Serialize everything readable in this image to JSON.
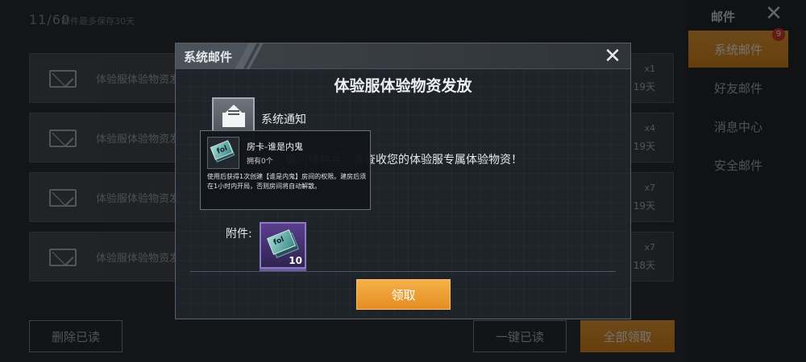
{
  "background": {
    "counter": "11/60",
    "keep_note": "邮件最多保存30天",
    "mails": [
      {
        "title": "体验服体验物资发",
        "qty": "x1",
        "days": "19天"
      },
      {
        "title": "体验服体验物资发",
        "qty": "x4",
        "days": "19天"
      },
      {
        "title": "体验服体验物资发",
        "qty": "x7",
        "days": "19天"
      },
      {
        "title": "体验服体验物资发",
        "qty": "x7",
        "days": "18天"
      }
    ],
    "delete_read_label": "删除已读",
    "mark_all_read_label": "一键已读",
    "claim_all_label": "全部领取"
  },
  "sidebar": {
    "header": "邮件",
    "badge": "9",
    "tabs": [
      {
        "label": "系统邮件"
      },
      {
        "label": "好友邮件"
      },
      {
        "label": "消息中心"
      },
      {
        "label": "安全邮件"
      }
    ]
  },
  "modal": {
    "title": "系统邮件",
    "heading": "体验服体验物资发放",
    "sender": "系统通知",
    "body_visible": "敬的特种兵：请查收您的体验服专属体验物资！",
    "attach_label": "附件:",
    "attach_qty": "10",
    "claim_label": "领取"
  },
  "tooltip": {
    "name": "房卡-谁是内鬼",
    "owned": "拥有0个",
    "description": "使用后获得1次创建【谁是内鬼】房间的权限。建房后须在1小时内开局，否则房间将自动解散。"
  },
  "colors": {
    "accent_orange": "#e8921f",
    "badge_red": "#e13b2a",
    "item_purple": "#5a3f8f"
  },
  "icons": [
    "mail-icon",
    "close-icon",
    "envelope-icon",
    "room-card-icon"
  ]
}
